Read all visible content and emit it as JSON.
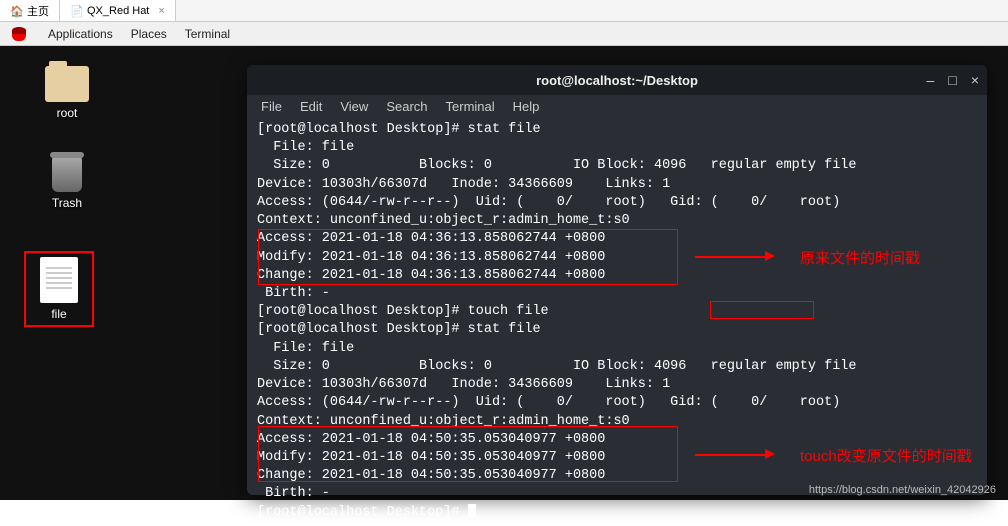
{
  "browser_tabs": [
    {
      "label": "主页",
      "icon": "home"
    },
    {
      "label": "QX_Red Hat",
      "icon": "doc"
    }
  ],
  "menubar": {
    "applications": "Applications",
    "places": "Places",
    "terminal": "Terminal"
  },
  "desktop_icons": {
    "root": "root",
    "trash": "Trash",
    "file": "file"
  },
  "terminal": {
    "title": "root@localhost:~/Desktop",
    "menus": [
      "File",
      "Edit",
      "View",
      "Search",
      "Terminal",
      "Help"
    ],
    "lines": [
      "[root@localhost Desktop]# stat file",
      "  File: file",
      "  Size: 0           Blocks: 0          IO Block: 4096   regular empty file",
      "Device: 10303h/66307d   Inode: 34366609    Links: 1",
      "Access: (0644/-rw-r--r--)  Uid: (    0/    root)   Gid: (    0/    root)",
      "Context: unconfined_u:object_r:admin_home_t:s0",
      "Access: 2021-01-18 04:36:13.858062744 +0800",
      "Modify: 2021-01-18 04:36:13.858062744 +0800",
      "Change: 2021-01-18 04:36:13.858062744 +0800",
      " Birth: -",
      "[root@localhost Desktop]# touch file",
      "[root@localhost Desktop]# stat file",
      "  File: file",
      "  Size: 0           Blocks: 0          IO Block: 4096   regular empty file",
      "Device: 10303h/66307d   Inode: 34366609    Links: 1",
      "Access: (0644/-rw-r--r--)  Uid: (    0/    root)   Gid: (    0/    root)",
      "Context: unconfined_u:object_r:admin_home_t:s0",
      "Access: 2021-01-18 04:50:35.053040977 +0800",
      "Modify: 2021-01-18 04:50:35.053040977 +0800",
      "Change: 2021-01-18 04:50:35.053040977 +0800",
      " Birth: -",
      "[root@localhost Desktop]# "
    ]
  },
  "annotations": {
    "ann1": "原来文件的时间戳",
    "ann2": "touch改变原文件的时间戳"
  },
  "watermark": "https://blog.csdn.net/weixin_42042926"
}
